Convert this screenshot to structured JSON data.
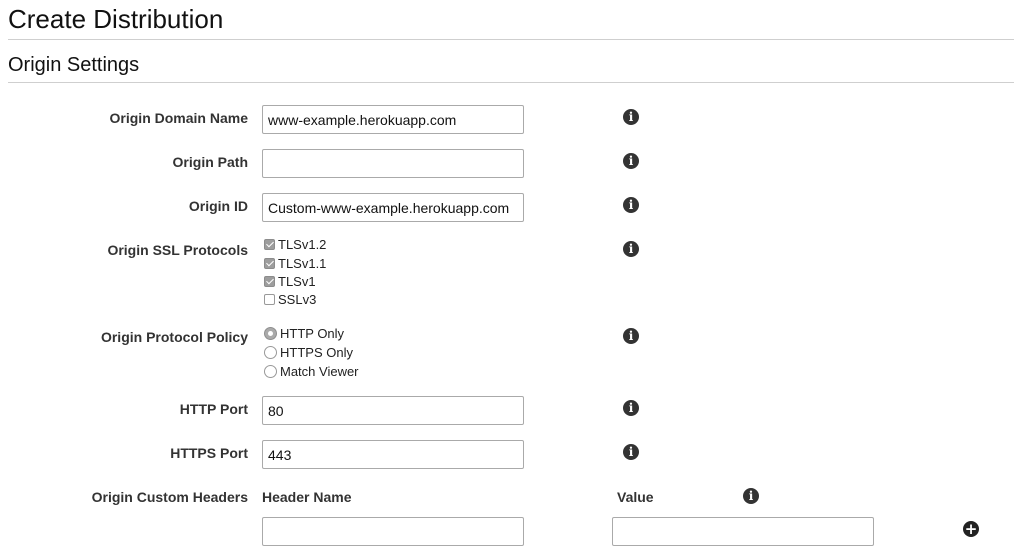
{
  "header": {
    "title": "Create Distribution"
  },
  "section": {
    "title": "Origin Settings"
  },
  "fields": {
    "origin_domain_name": {
      "label": "Origin Domain Name",
      "value": "www-example.herokuapp.com",
      "placeholder": ""
    },
    "origin_path": {
      "label": "Origin Path",
      "value": "",
      "placeholder": ""
    },
    "origin_id": {
      "label": "Origin ID",
      "value": "Custom-www-example.herokuapp.com",
      "placeholder": ""
    },
    "http_port": {
      "label": "HTTP Port",
      "value": "80",
      "placeholder": ""
    },
    "https_port": {
      "label": "HTTPS Port",
      "value": "443",
      "placeholder": ""
    }
  },
  "ssl_protocols": {
    "label": "Origin SSL Protocols",
    "options": [
      {
        "label": "TLSv1.2",
        "checked": true
      },
      {
        "label": "TLSv1.1",
        "checked": true
      },
      {
        "label": "TLSv1",
        "checked": true
      },
      {
        "label": "SSLv3",
        "checked": false
      }
    ]
  },
  "protocol_policy": {
    "label": "Origin Protocol Policy",
    "options": [
      {
        "label": "HTTP Only",
        "selected": true
      },
      {
        "label": "HTTPS Only",
        "selected": false
      },
      {
        "label": "Match Viewer",
        "selected": false
      }
    ]
  },
  "custom_headers": {
    "label": "Origin Custom Headers",
    "header_name_label": "Header Name",
    "value_label": "Value",
    "header_name_value": "",
    "value_value": ""
  },
  "icons": {
    "info": "info-icon",
    "add": "plus-circle-icon",
    "info_glyph": "i",
    "add_glyph": "+"
  },
  "colors": {
    "text": "#333333",
    "rule": "#cfcfcf",
    "input_border": "#aaaaaa",
    "icon": "#333333"
  }
}
